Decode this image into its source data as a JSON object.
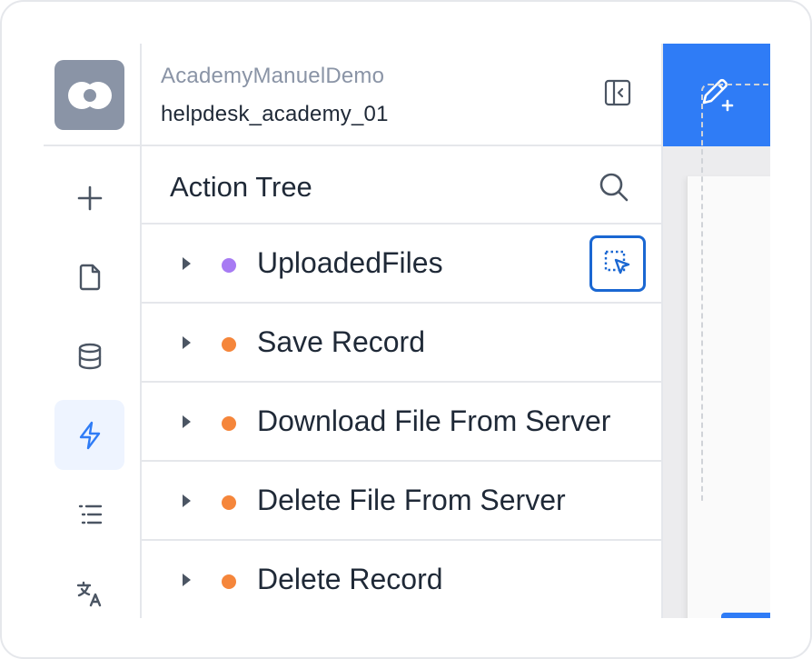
{
  "app": {
    "name": "AcademyManuelDemo",
    "id": "helpdesk_academy_01"
  },
  "rail": {
    "items": [
      {
        "icon": "plus-icon"
      },
      {
        "icon": "file-icon"
      },
      {
        "icon": "database-icon"
      },
      {
        "icon": "lightning-icon",
        "active": true
      },
      {
        "icon": "list-icon"
      },
      {
        "icon": "translate-icon"
      }
    ]
  },
  "panel": {
    "title": "Action Tree"
  },
  "actions": [
    {
      "label": "UploadedFiles",
      "dot_color": "#a77bf3"
    },
    {
      "label": "Save Record",
      "dot_color": "#f5863b"
    },
    {
      "label": "Download File From Server",
      "dot_color": "#f5863b"
    },
    {
      "label": "Delete File From Server",
      "dot_color": "#f5863b"
    },
    {
      "label": "Delete Record",
      "dot_color": "#f5863b"
    }
  ],
  "colors": {
    "accent": "#2f7cf6",
    "active_rail_bg": "#eef4ff",
    "select_border": "#1a67d2"
  }
}
